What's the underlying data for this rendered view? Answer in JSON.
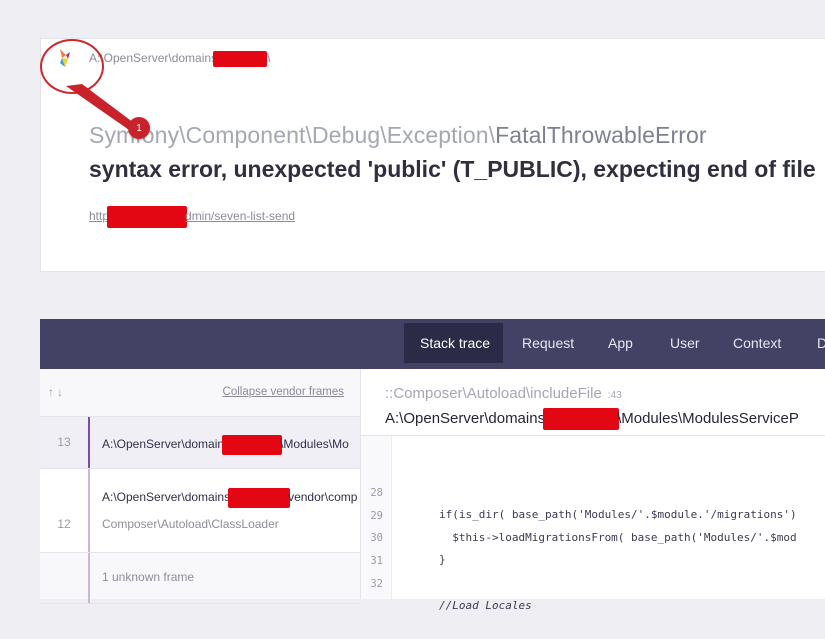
{
  "header": {
    "path_prefix": "A:\\OpenServer\\domains",
    "path_suffix": "\\",
    "exception_namespace": "Symfony\\Component\\Debug\\Exception\\",
    "exception_class": "FatalThrowableError",
    "message": "syntax error, unexpected 'public' (T_PUBLIC), expecting end of file",
    "url_prefix": "http",
    "url_suffix": "dmin/seven-list-send",
    "annotation_number": "1"
  },
  "tabs": [
    {
      "label": "Stack trace",
      "active": true
    },
    {
      "label": "Request"
    },
    {
      "label": "App"
    },
    {
      "label": "User"
    },
    {
      "label": "Context"
    },
    {
      "label": "D"
    }
  ],
  "frames_header": {
    "sort_arrows": "↑↓",
    "collapse_label": "Collapse vendor frames"
  },
  "frames": [
    {
      "number": "13",
      "file_prefix": "A:\\OpenServer\\domain",
      "file_suffix": "\\Modules\\Mo",
      "active": true
    },
    {
      "number": "12",
      "file_prefix": "A:\\OpenServer\\domains",
      "file_suffix": "vendor\\comp",
      "class": "Composer\\Autoload\\ClassLoader"
    },
    {
      "label": "1 unknown frame"
    }
  ],
  "code_view": {
    "function": "::Composer\\Autoload\\includeFile",
    "line": ":43",
    "file_prefix": "A:\\OpenServer\\domains",
    "file_suffix": "\\Modules\\ModulesServiceP",
    "lines": [
      {
        "number": "28",
        "code": "if(is_dir( base_path('Modules/'.$module.'/migrations')"
      },
      {
        "number": "29",
        "code": "  $this->loadMigrationsFrom( base_path('Modules/'.$mod"
      },
      {
        "number": "30",
        "code": "}"
      },
      {
        "number": "31",
        "code": ""
      },
      {
        "number": "32",
        "code": "//Load Locales"
      }
    ]
  },
  "colors": {
    "tabbar": "#444264",
    "active_tab": "#2c2b47",
    "redaction": "#e30613",
    "annotation": "#d0272c",
    "active_frame_bar": "#7e4aab"
  }
}
